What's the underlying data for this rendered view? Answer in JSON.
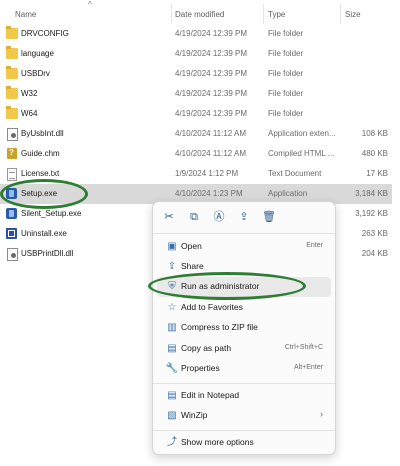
{
  "columns": {
    "name": "Name",
    "date": "Date modified",
    "type": "Type",
    "size": "Size"
  },
  "files": [
    {
      "name": "DRVCONFIG",
      "date": "4/19/2024 12:39 PM",
      "type": "File folder",
      "size": "",
      "icon": "folder-icon"
    },
    {
      "name": "language",
      "date": "4/19/2024 12:39 PM",
      "type": "File folder",
      "size": "",
      "icon": "folder-icon"
    },
    {
      "name": "USBDrv",
      "date": "4/19/2024 12:39 PM",
      "type": "File folder",
      "size": "",
      "icon": "folder-icon"
    },
    {
      "name": "W32",
      "date": "4/19/2024 12:39 PM",
      "type": "File folder",
      "size": "",
      "icon": "folder-icon"
    },
    {
      "name": "W64",
      "date": "4/19/2024 12:39 PM",
      "type": "File folder",
      "size": "",
      "icon": "folder-icon"
    },
    {
      "name": "ByUsbInt.dll",
      "date": "4/10/2024 11:12 AM",
      "type": "Application exten...",
      "size": "108 KB",
      "icon": "dll-file-icon"
    },
    {
      "name": "Guide.chm",
      "date": "4/10/2024 11:12 AM",
      "type": "Compiled HTML ...",
      "size": "480 KB",
      "icon": "help-file-icon"
    },
    {
      "name": "License.txt",
      "date": "1/9/2024 1:12 PM",
      "type": "Text Document",
      "size": "17 KB",
      "icon": "text-file-icon"
    },
    {
      "name": "Setup.exe",
      "date": "4/10/2024 1:23 PM",
      "type": "Application",
      "size": "3,184 KB",
      "icon": "setup-exe-icon",
      "selected": true
    },
    {
      "name": "Silent_Setup.exe",
      "date": "",
      "type": "",
      "size": "3,192 KB",
      "icon": "setup-exe-icon"
    },
    {
      "name": "Uninstall.exe",
      "date": "",
      "type": "",
      "size": "263 KB",
      "icon": "uninstall-exe-icon"
    },
    {
      "name": "USBPrintDll.dll",
      "date": "",
      "type": "",
      "size": "204 KB",
      "icon": "dll-file-icon"
    }
  ],
  "quick_actions": [
    {
      "icon": "cut-icon",
      "glyph": "✂"
    },
    {
      "icon": "copy-icon",
      "glyph": "⧉"
    },
    {
      "icon": "rename-icon",
      "glyph": "Ⓐ"
    },
    {
      "icon": "share-icon",
      "glyph": "⇪"
    },
    {
      "icon": "delete-icon",
      "glyph": "🗑"
    }
  ],
  "menu": {
    "group1": [
      {
        "label": "Open",
        "shortcut": "Enter",
        "icon": "open-icon",
        "glyph": "▣"
      },
      {
        "label": "Share",
        "shortcut": "",
        "icon": "share-icon",
        "glyph": "⇪"
      },
      {
        "label": "Run as administrator",
        "shortcut": "",
        "icon": "shield-icon",
        "glyph": "⛨",
        "highlighted": true
      },
      {
        "label": "Add to Favorites",
        "shortcut": "",
        "icon": "star-icon",
        "glyph": "☆"
      },
      {
        "label": "Compress to ZIP file",
        "shortcut": "",
        "icon": "zip-icon",
        "glyph": "▥"
      },
      {
        "label": "Copy as path",
        "shortcut": "Ctrl+Shift+C",
        "icon": "copy-path-icon",
        "glyph": "▤"
      },
      {
        "label": "Properties",
        "shortcut": "Alt+Enter",
        "icon": "wrench-icon",
        "glyph": "🔧"
      }
    ],
    "group2": [
      {
        "label": "Edit in Notepad",
        "shortcut": "",
        "icon": "notepad-icon",
        "glyph": "▤"
      },
      {
        "label": "WinZip",
        "shortcut": "",
        "icon": "winzip-icon",
        "glyph": "▧",
        "submenu": true
      }
    ],
    "group3": [
      {
        "label": "Show more options",
        "shortcut": "",
        "icon": "more-options-icon",
        "glyph": "⤴"
      }
    ]
  },
  "colors": {
    "annotation_ring": "#2e7d32",
    "selection": "#d9d9d9",
    "accent": "#3a6ea5"
  }
}
